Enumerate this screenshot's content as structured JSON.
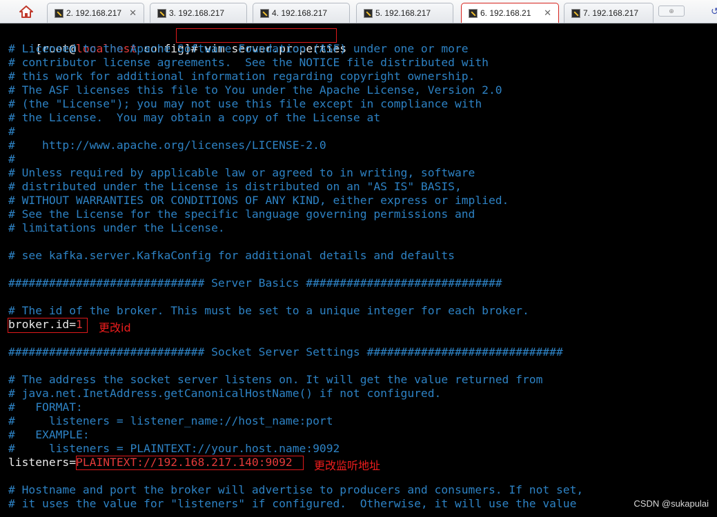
{
  "tabs": [
    {
      "label": "2. 192.168.217",
      "active": false
    },
    {
      "label": "3. 192.168.217",
      "active": false
    },
    {
      "label": "4. 192.168.217",
      "active": false
    },
    {
      "label": "5. 192.168.217",
      "active": false
    },
    {
      "label": "6. 192.168.21",
      "active": true
    },
    {
      "label": "7. 192.168.217",
      "active": false
    }
  ],
  "close_glyph": "✕",
  "prompt": {
    "open": "[root@",
    "host": "localhost",
    "rest": " config]# ",
    "command": "vim server.properties"
  },
  "comments_top": [
    "# Licensed to the Apache Software Foundation (ASF) under one or more",
    "# contributor license agreements.  See the NOTICE file distributed with",
    "# this work for additional information regarding copyright ownership.",
    "# The ASF licenses this file to You under the Apache License, Version 2.0",
    "# (the \"License\"); you may not use this file except in compliance with",
    "# the License.  You may obtain a copy of the License at",
    "#",
    "#    http://www.apache.org/licenses/LICENSE-2.0",
    "#",
    "# Unless required by applicable law or agreed to in writing, software",
    "# distributed under the License is distributed on an \"AS IS\" BASIS,",
    "# WITHOUT WARRANTIES OR CONDITIONS OF ANY KIND, either express or implied.",
    "# See the License for the specific language governing permissions and",
    "# limitations under the License."
  ],
  "see_line": "# see kafka.server.KafkaConfig for additional details and defaults",
  "server_basics": "############################# Server Basics #############################",
  "broker_comment": "# The id of the broker. This must be set to a unique integer for each broker.",
  "broker": {
    "key": "broker.id=",
    "value": "1"
  },
  "broker_annotation": "更改id",
  "socket_settings": "############################# Socket Server Settings #############################",
  "socket_comments": [
    "# The address the socket server listens on. It will get the value returned from",
    "# java.net.InetAddress.getCanonicalHostName() if not configured.",
    "#   FORMAT:",
    "#     listeners = listener_name://host_name:port",
    "#   EXAMPLE:",
    "#     listeners = PLAINTEXT://your.host.name:9092"
  ],
  "listeners": {
    "key": "listeners=",
    "value": "PLAINTEXT://192.168.217.140:9092"
  },
  "listeners_annotation": "更改监听地址",
  "hostname_comments": [
    "# Hostname and port the broker will advertise to producers and consumers. If not set,",
    "# it uses the value for \"listeners\" if configured.  Otherwise, it will use the value"
  ],
  "watermark": "CSDN @sukapulai",
  "colors": {
    "comment": "#2d82c4",
    "text": "#eaeaea",
    "highlight": "#e33a3a",
    "annotation": "#ee1d1d"
  }
}
